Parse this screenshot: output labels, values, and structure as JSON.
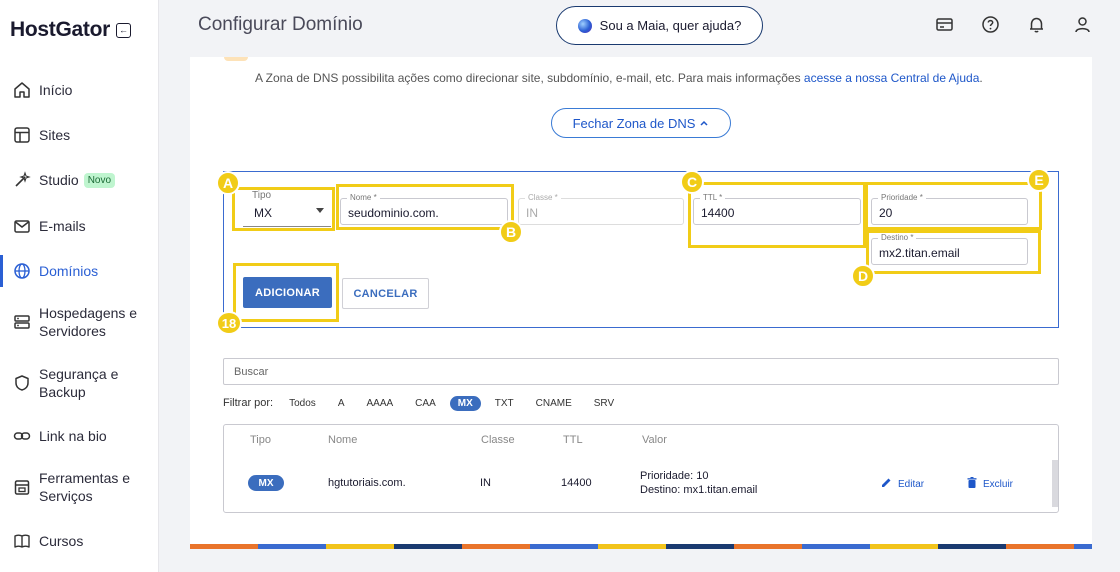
{
  "brand": {
    "name": "HostGator"
  },
  "sidebar": {
    "items": [
      {
        "label": "Início",
        "icon": "home-icon"
      },
      {
        "label": "Sites",
        "icon": "layout-icon"
      },
      {
        "label": "Studio",
        "icon": "magic-wand-icon",
        "badge": "Novo"
      },
      {
        "label": "E-mails",
        "icon": "mail-icon"
      },
      {
        "label": "Domínios",
        "icon": "globe-icon",
        "active": true
      },
      {
        "label": "Hospedagens e Servidores",
        "icon": "server-icon"
      },
      {
        "label": "Segurança e Backup",
        "icon": "shield-icon"
      },
      {
        "label": "Link na bio",
        "icon": "link-icon"
      },
      {
        "label": "Ferramentas e Serviços",
        "icon": "tools-icon"
      },
      {
        "label": "Cursos",
        "icon": "book-icon"
      }
    ]
  },
  "header": {
    "title": "Configurar Domínio",
    "assistant_label": "Sou a Maia, quer ajuda?",
    "icons": [
      "card-icon",
      "help-icon",
      "bell-icon",
      "user-icon"
    ]
  },
  "dns": {
    "info_text": "A Zona de DNS possibilita ações como direcionar site, subdomínio, e-mail, etc. Para mais informações ",
    "info_link": "acesse a nossa Central de Ajuda",
    "info_end": ".",
    "close_label": "Fechar Zona de DNS"
  },
  "form": {
    "tipo_label": "Tipo",
    "tipo_value": "MX",
    "nome_label": "Nome *",
    "nome_value": "seudominio.com.",
    "classe_label": "Classe *",
    "classe_value": "IN",
    "ttl_label": "TTL *",
    "ttl_value": "14400",
    "prioridade_label": "Prioridade *",
    "prioridade_value": "20",
    "destino_label": "Destino *",
    "destino_value": "mx2.titan.email",
    "add_label": "ADICIONAR",
    "cancel_label": "CANCELAR"
  },
  "annotations": {
    "a": "A",
    "b": "B",
    "c": "C",
    "d": "D",
    "e": "E",
    "step": "18",
    "color": "#f1cc17"
  },
  "records": {
    "search_placeholder": "Buscar",
    "filter_label": "Filtrar por:",
    "filters": [
      "Todos",
      "A",
      "AAAA",
      "CAA",
      "MX",
      "TXT",
      "CNAME",
      "SRV"
    ],
    "active_filter": "MX",
    "columns": [
      "Tipo",
      "Nome",
      "Classe",
      "TTL",
      "Valor"
    ],
    "rows": [
      {
        "tipo": "MX",
        "nome": "hgtutoriais.com.",
        "classe": "IN",
        "ttl": "14400",
        "valor_prioridade": "Prioridade: 10",
        "valor_destino": "Destino: mx1.titan.email",
        "edit": "Editar",
        "delete": "Excluir"
      }
    ]
  },
  "colors": {
    "accent": "#3b6dbe",
    "link": "#1e57c9",
    "highlight": "#f1cc17"
  }
}
